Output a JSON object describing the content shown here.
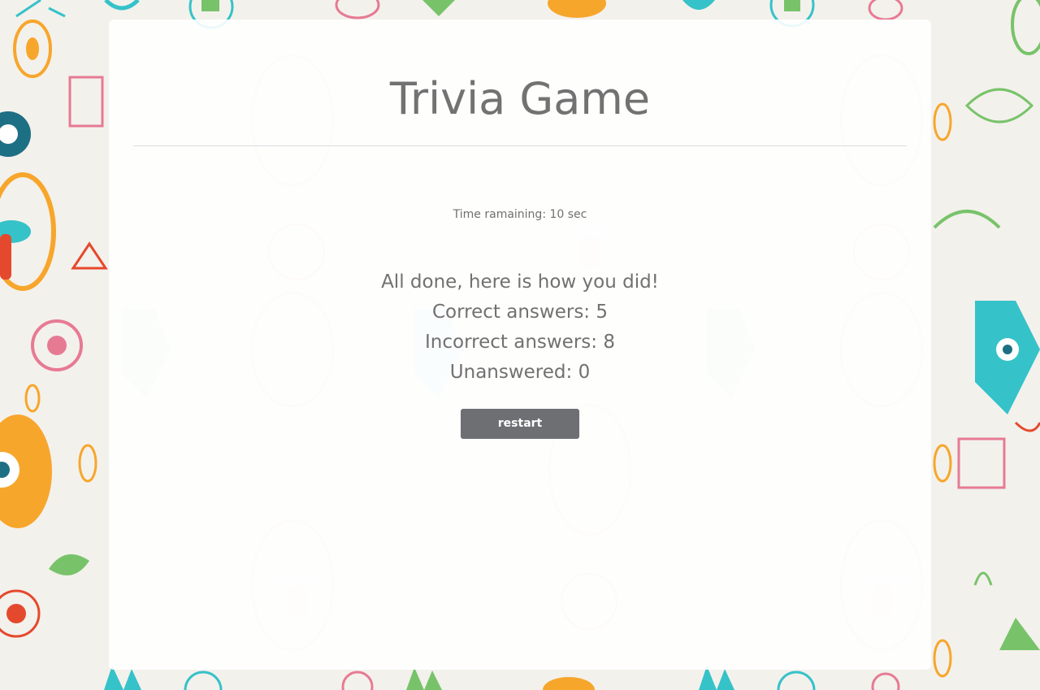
{
  "page": {
    "title": "Trivia Game"
  },
  "timer": {
    "label": "Time ramaining: 10 sec"
  },
  "results": {
    "summary": "All done, here is how you did!",
    "correct": "Correct answers: 5",
    "incorrect": "Incorrect answers: 8",
    "unanswered": "Unanswered: 0"
  },
  "actions": {
    "restart_label": "restart"
  },
  "colors": {
    "page_background": "#f3f1ec",
    "text": "#717171",
    "button_background": "#6d6f73",
    "button_text": "#ffffff",
    "pattern_orange": "#f7a62c",
    "pattern_teal": "#35c2c9",
    "pattern_pink": "#e77a93",
    "pattern_green": "#78c36a"
  }
}
